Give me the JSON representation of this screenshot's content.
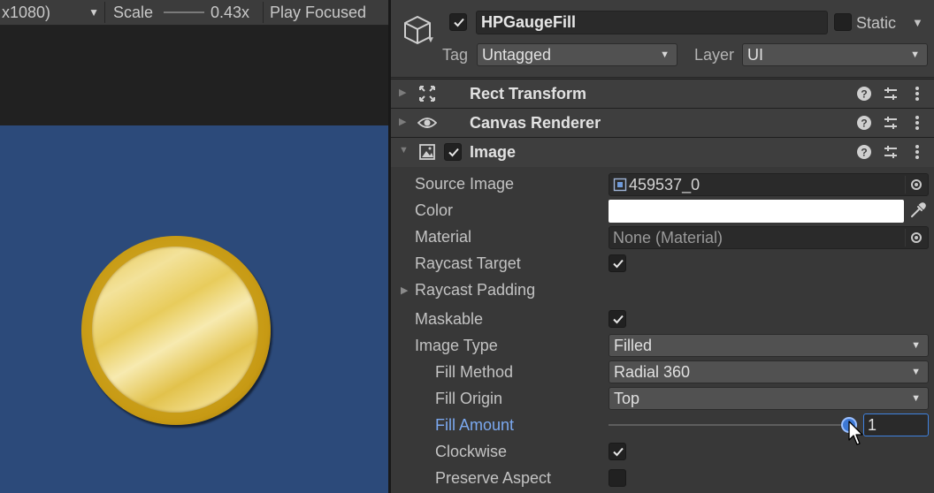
{
  "game_view": {
    "resolution": "x1080)",
    "scale_label": "Scale",
    "scale_value": "0.43x",
    "play_mode": "Play Focused"
  },
  "inspector": {
    "gameobject": {
      "name": "HPGaugeFill",
      "active": true,
      "static_label": "Static",
      "static": false,
      "tag_label": "Tag",
      "tag": "Untagged",
      "layer_label": "Layer",
      "layer": "UI"
    },
    "components": [
      {
        "title": "Rect Transform",
        "icon": "rect-transform-icon",
        "expanded": false
      },
      {
        "title": "Canvas Renderer",
        "icon": "eye-icon",
        "expanded": false
      },
      {
        "title": "Image",
        "icon": "image-component-icon",
        "expanded": true,
        "enabled": true
      }
    ],
    "image": {
      "source_image_label": "Source Image",
      "source_image": "459537_0",
      "color_label": "Color",
      "color": "#ffffff",
      "material_label": "Material",
      "material": "None (Material)",
      "raycast_target_label": "Raycast Target",
      "raycast_target": true,
      "raycast_padding_label": "Raycast Padding",
      "maskable_label": "Maskable",
      "maskable": true,
      "image_type_label": "Image Type",
      "image_type": "Filled",
      "fill_method_label": "Fill Method",
      "fill_method": "Radial 360",
      "fill_origin_label": "Fill Origin",
      "fill_origin": "Top",
      "fill_amount_label": "Fill Amount",
      "fill_amount": "1",
      "clockwise_label": "Clockwise",
      "clockwise": true,
      "preserve_aspect_label": "Preserve Aspect",
      "preserve_aspect": false
    }
  },
  "colors": {
    "canvas_background": "#2c4a7a",
    "accent": "#3d78d4",
    "highlight_label": "#7ba8ef"
  }
}
